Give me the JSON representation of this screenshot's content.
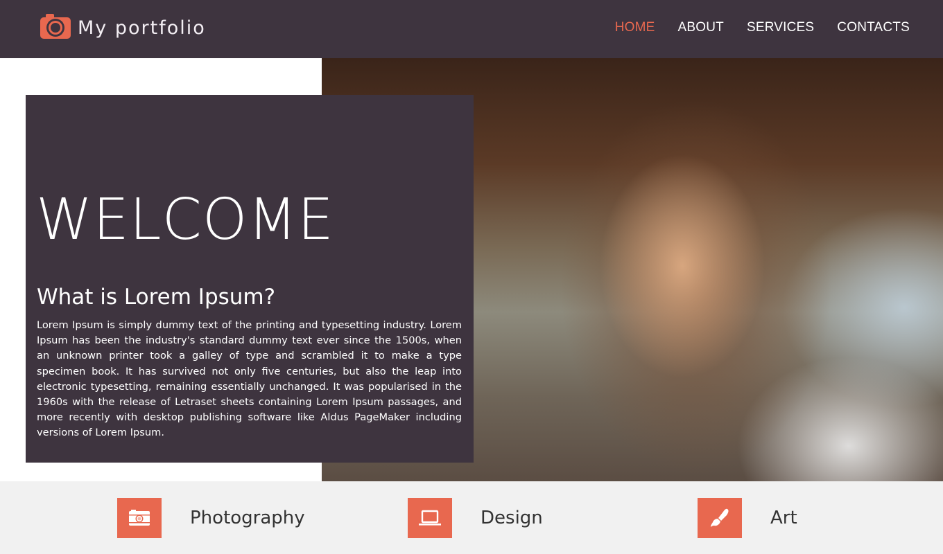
{
  "header": {
    "logo_icon": "camera-icon",
    "title": "My portfolio",
    "nav": [
      {
        "label": "HOME",
        "active": true
      },
      {
        "label": "ABOUT",
        "active": false
      },
      {
        "label": "SERVICES",
        "active": false
      },
      {
        "label": "CONTACTS",
        "active": false
      }
    ]
  },
  "hero": {
    "heading": "WELCOME",
    "subtitle": "What is Lorem Ipsum?",
    "body": "Lorem Ipsum is simply dummy text of the printing and typesetting industry. Lorem Ipsum has been the industry's standard dummy text ever since the 1500s, when an unknown printer took a galley of type and scrambled it to make a type specimen book. It has survived not only five centuries, but also the leap into electronic typesetting, remaining essentially unchanged. It was popularised in the 1960s with the release of Letraset sheets containing Lorem Ipsum passages, and more recently with desktop publishing software like Aldus PageMaker including versions of Lorem Ipsum.",
    "image": "portrait-photo"
  },
  "services": [
    {
      "label": "Photography",
      "icon": "camera-icon"
    },
    {
      "label": "Design",
      "icon": "laptop-icon"
    },
    {
      "label": "Art",
      "icon": "paintbrush-icon"
    }
  ],
  "colors": {
    "primary_dark": "#3e343f",
    "accent": "#e8684f",
    "services_bg": "#f1f1f1"
  }
}
